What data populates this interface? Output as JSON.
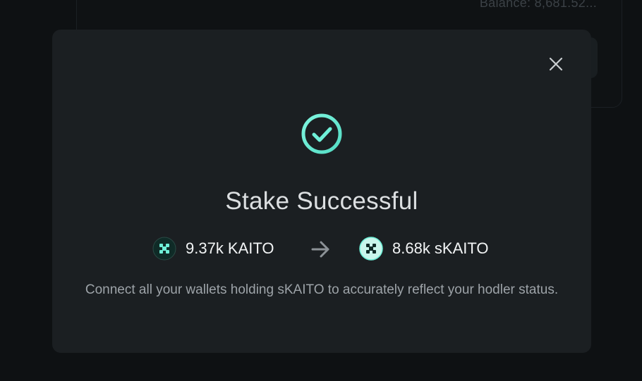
{
  "background": {
    "balance_text": "Balance: 8,681.52..."
  },
  "modal": {
    "close_icon": "close-icon",
    "success_icon": "check-circle-icon",
    "title": "Stake Successful",
    "from_token": {
      "amount": "9.37k KAITO",
      "icon": "kaito-token-icon"
    },
    "arrow_icon": "arrow-right-icon",
    "to_token": {
      "amount": "8.68k sKAITO",
      "icon": "skaito-token-icon"
    },
    "note": "Connect all your wallets holding sKAITO to accurately reflect your hodler status."
  },
  "colors": {
    "accent": "#6ff0d8",
    "modal_bg": "#1b1f22",
    "page_bg": "#0e1113"
  }
}
